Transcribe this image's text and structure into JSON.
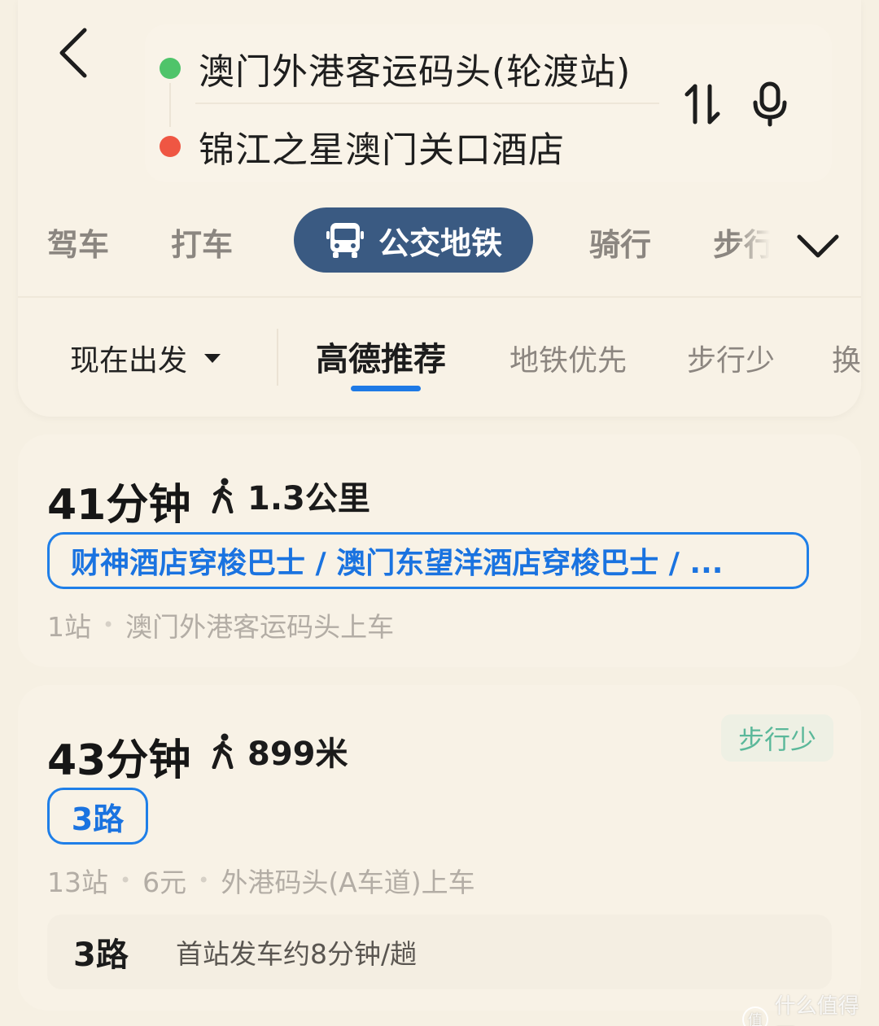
{
  "route": {
    "origin": "澳门外港客运码头(轮渡站)",
    "destination": "锦江之星澳门关口酒店"
  },
  "modes": {
    "drive": "驾车",
    "taxi": "打车",
    "transit": "公交地铁",
    "bike": "骑行",
    "walk": "步行"
  },
  "filters": {
    "depart": "现在出发",
    "recommended": "高德推荐",
    "metro_first": "地铁优先",
    "less_walk": "步行少",
    "transfer": "换"
  },
  "results": [
    {
      "duration": "41分钟",
      "walk": "1.3公里",
      "lines": "财神酒店穿梭巴士 / 澳门东望洋酒店穿梭巴士 / ...",
      "stops": "1站",
      "boarding": "澳门外港客运码头上车"
    },
    {
      "duration": "43分钟",
      "walk": "899米",
      "badge": "步行少",
      "lines": "3路",
      "stops": "13站",
      "fare": "6元",
      "boarding": "外港码头(A车道)上车",
      "freq_line": "3路",
      "freq_text": "首站发车约8分钟/趟"
    }
  ],
  "watermark": "什么值得买",
  "colors": {
    "background": "#f6f0e3",
    "transit_active": "#3a5a82",
    "accent_blue": "#1e7ae6",
    "origin_dot": "#4fc46a",
    "destination_dot": "#ef5643",
    "badge_green": "#5bb89a"
  }
}
